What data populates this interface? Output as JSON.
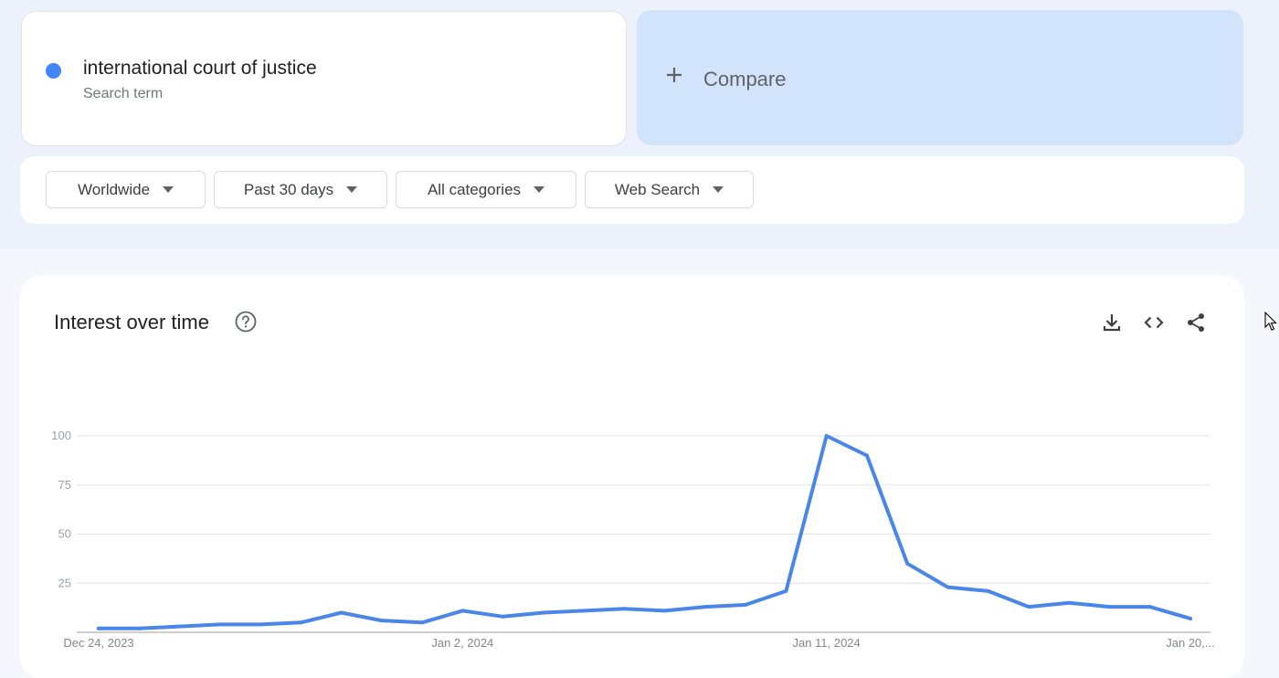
{
  "search_term": {
    "name": "international court of justice",
    "subtitle": "Search term",
    "color": "#4285f4"
  },
  "compare": {
    "label": "Compare",
    "icon": "plus-icon"
  },
  "filters": [
    {
      "label": "Worldwide",
      "icon": "caret-down-icon"
    },
    {
      "label": "Past 30 days",
      "icon": "caret-down-icon"
    },
    {
      "label": "All categories",
      "icon": "caret-down-icon"
    },
    {
      "label": "Web Search",
      "icon": "caret-down-icon"
    }
  ],
  "chart_panel": {
    "title": "Interest over time",
    "help_icon": "help-circle-icon",
    "actions": [
      "download-icon",
      "embed-code-icon",
      "share-icon"
    ]
  },
  "chart_data": {
    "type": "line",
    "title": "Interest over time",
    "x": [
      "2023-12-24",
      "2023-12-25",
      "2023-12-26",
      "2023-12-27",
      "2023-12-28",
      "2023-12-29",
      "2023-12-30",
      "2023-12-31",
      "2024-01-01",
      "2024-01-02",
      "2024-01-03",
      "2024-01-04",
      "2024-01-05",
      "2024-01-06",
      "2024-01-07",
      "2024-01-08",
      "2024-01-09",
      "2024-01-10",
      "2024-01-11",
      "2024-01-12",
      "2024-01-13",
      "2024-01-14",
      "2024-01-15",
      "2024-01-16",
      "2024-01-17",
      "2024-01-18",
      "2024-01-19",
      "2024-01-20"
    ],
    "x_tick_labels": [
      "Dec 24, 2023",
      "Jan 2, 2024",
      "Jan 11, 2024",
      "Jan 20,..."
    ],
    "x_tick_indices": [
      0,
      9,
      18,
      27
    ],
    "y_ticks": [
      25,
      50,
      75,
      100
    ],
    "ylim": [
      0,
      100
    ],
    "grid": true,
    "series": [
      {
        "color": "#4a86e8",
        "values": [
          2,
          2,
          3,
          4,
          4,
          5,
          10,
          6,
          5,
          11,
          8,
          10,
          11,
          12,
          11,
          13,
          14,
          21,
          100,
          90,
          35,
          23,
          21,
          13,
          15,
          13,
          13,
          7
        ]
      }
    ]
  }
}
